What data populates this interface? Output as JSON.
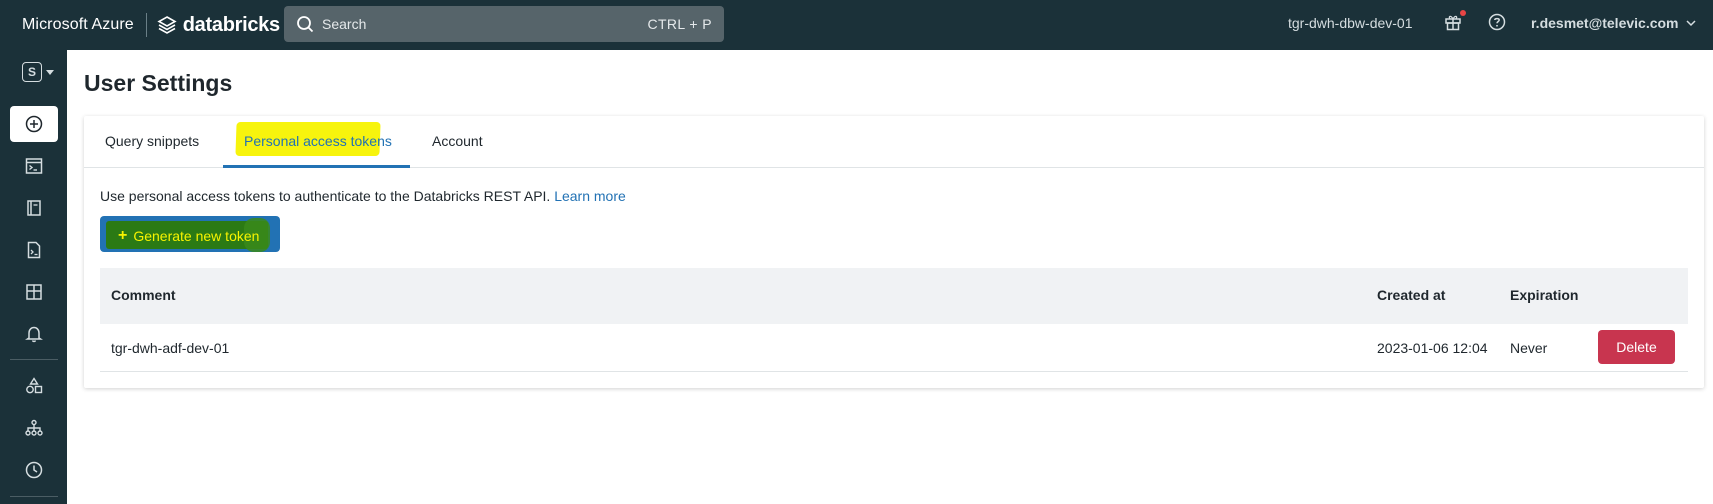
{
  "topbar": {
    "brand_ms": "Microsoft Azure",
    "brand_db": "databricks",
    "search_placeholder": "Search",
    "search_shortcut": "CTRL + P",
    "workspace": "tgr-dwh-dbw-dev-01",
    "user": "r.desmet@televic.com"
  },
  "sidebar": {
    "persona": "S",
    "items": [
      "create-icon",
      "sql-editor-icon",
      "queries-icon",
      "alerts-file-icon",
      "dashboards-icon",
      "bell-icon",
      "data-shapes-icon",
      "workflows-icon",
      "history-icon"
    ]
  },
  "page": {
    "title": "User Settings"
  },
  "tabs": [
    {
      "label": "Query snippets"
    },
    {
      "label": "Personal access tokens"
    },
    {
      "label": "Account"
    }
  ],
  "tokens": {
    "description": "Use personal access tokens to authenticate to the Databricks REST API.",
    "learn_more": "Learn more",
    "generate_label": "Generate new token",
    "columns": [
      "Comment",
      "Created at",
      "Expiration"
    ],
    "rows": [
      {
        "comment": "tgr-dwh-adf-dev-01",
        "created_at": "2023-01-06 12:04",
        "expiration": "Never",
        "action": "Delete"
      }
    ]
  },
  "colors": {
    "topbar_bg": "#1b3139",
    "accent": "#2272b4",
    "danger": "#c8354f",
    "highlight_yellow": "#f7f300",
    "highlight_green": "#2b7a14"
  }
}
